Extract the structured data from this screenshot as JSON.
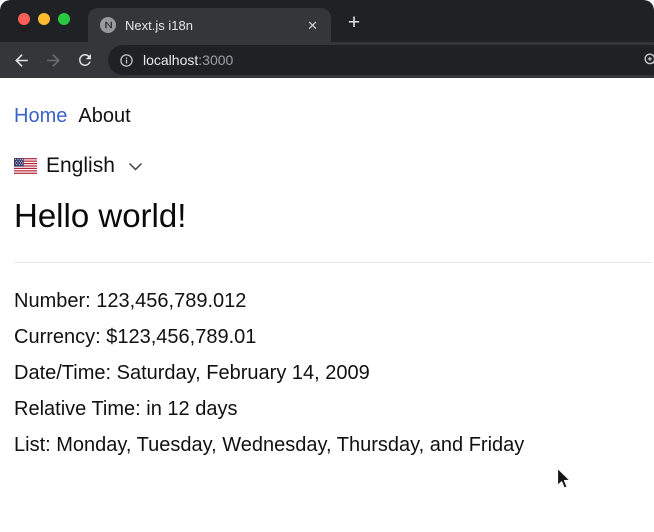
{
  "window": {
    "controls": [
      {
        "name": "close",
        "color": "#ff5f57"
      },
      {
        "name": "minimize",
        "color": "#febc2e"
      },
      {
        "name": "zoom",
        "color": "#28c840"
      }
    ]
  },
  "browser": {
    "tab": {
      "title": "Next.js i18n",
      "close_glyph": "✕"
    },
    "new_tab_glyph": "+",
    "url": {
      "host": "localhost",
      "port": ":3000"
    }
  },
  "page": {
    "nav": [
      {
        "label": "Home"
      },
      {
        "label": "About"
      }
    ],
    "language_switcher": {
      "flag": "us-flag-icon",
      "label": "English"
    },
    "heading": "Hello world!",
    "lines": [
      {
        "text": "Number: 123,456,789.012"
      },
      {
        "text": "Currency: $123,456,789.01"
      },
      {
        "text": "Date/Time: Saturday, February 14, 2009"
      },
      {
        "text": "Relative Time: in 12 days"
      },
      {
        "text": "List: Monday, Tuesday, Wednesday, Thursday, and Friday"
      }
    ]
  },
  "colors": {
    "frame": "#202124",
    "surface": "#35363a",
    "url_pill": "#202124",
    "tab_text": "#e4e6e9",
    "muted_text": "#9aa0a6",
    "page_text": "#111111",
    "link": "#3b62c9",
    "divider": "#e8e8e8"
  }
}
